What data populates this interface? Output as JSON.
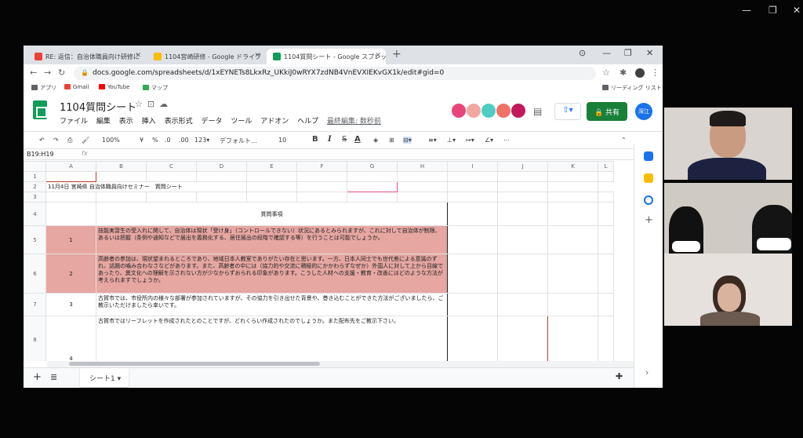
{
  "browser": {
    "tabs": [
      {
        "label": "RE: 返信：自治体職員向け研修に"
      },
      {
        "label": "1104宮崎研修 - Google ドライブ"
      },
      {
        "label": "1104質問シート - Google スプレッド"
      }
    ],
    "url": "docs.google.com/spreadsheets/d/1xEYNETs8LkxRz_UKkiJ0wRYX7zdNB4VnEVXIEKvGX1k/edit#gid=0",
    "bookmarks": [
      "アプリ",
      "Gmail",
      "YouTube",
      "マップ"
    ],
    "reading_list": "リーディング リスト"
  },
  "app": {
    "doc_title": "1104質問シート",
    "menus": [
      "ファイル",
      "編集",
      "表示",
      "挿入",
      "表示形式",
      "データ",
      "ツール",
      "アドオン",
      "ヘルプ"
    ],
    "last_edit": "最終編集: 数秒前",
    "share_label": "共有",
    "user_initials": "深江"
  },
  "toolbar": {
    "zoom": "100%",
    "currency": "¥",
    "percent": "%",
    "dec_less": ".0",
    "dec_more": ".00",
    "more_formats": "123▾",
    "font": "デフォルト...",
    "font_size": "10",
    "bold": "B",
    "italic": "I",
    "strike": "S",
    "text_color": "A"
  },
  "formula_bar": {
    "name_box": "B19:H19",
    "fx": "fx"
  },
  "grid": {
    "columns": [
      "A",
      "B",
      "C",
      "D",
      "E",
      "F",
      "G",
      "H",
      "I",
      "J",
      "K",
      "L"
    ],
    "rows": [
      {
        "num": "1"
      },
      {
        "num": "2",
        "title": "11月4日 宮崎県 自治体職員向けセミナー　質問シート"
      },
      {
        "num": "3"
      },
      {
        "num": "4",
        "header": "質問事項"
      },
      {
        "num": "5",
        "idx": "1",
        "text": "技能実習生の受入れに関して、自治体は現状「受け身」（コントロールできない）状況にあるとみられますが、これに対して自治体が制限、あるいは把握（条例や通知などで届出を義務化する、居住届出の段階で確認する等）を行うことは可能でしょうか。"
      },
      {
        "num": "6",
        "idx": "2",
        "text": "高齢者の参加は、現状望まれるところであり、地域日本人教室でありがたい存在と思います。一方、日本人同士でも世代差による意識のずれ、話題の噛み合わなさなどがあります。また、高齢者の中には（協力的や交流に積極的にかかわらずなぜか）外国人に対して上から目線であったり、異文化への理解を示されない方が少なからずおられる印象があります。こうした人材への支援・教育・改善にはどのような方法が考えられますでしょうか。"
      },
      {
        "num": "7",
        "idx": "3",
        "text": "古賀市では、市役所内の様々な部署が参加されていますが、その協力を引き出せた背景や、巻き込むことができた方法がございましたら、ご教示いただけましたら幸いです。"
      },
      {
        "num": "8",
        "idx": "4",
        "text": "古賀市ではリーフレットを作成されたとのことですが、どれくらい作成されたのでしょうか。また配布先をご教示下さい。"
      }
    ]
  },
  "sheet_tab": "シート1 ▾",
  "colors": {
    "accent": "#188038",
    "pink": "#e6a6a1",
    "brand": "#0f9d58"
  }
}
